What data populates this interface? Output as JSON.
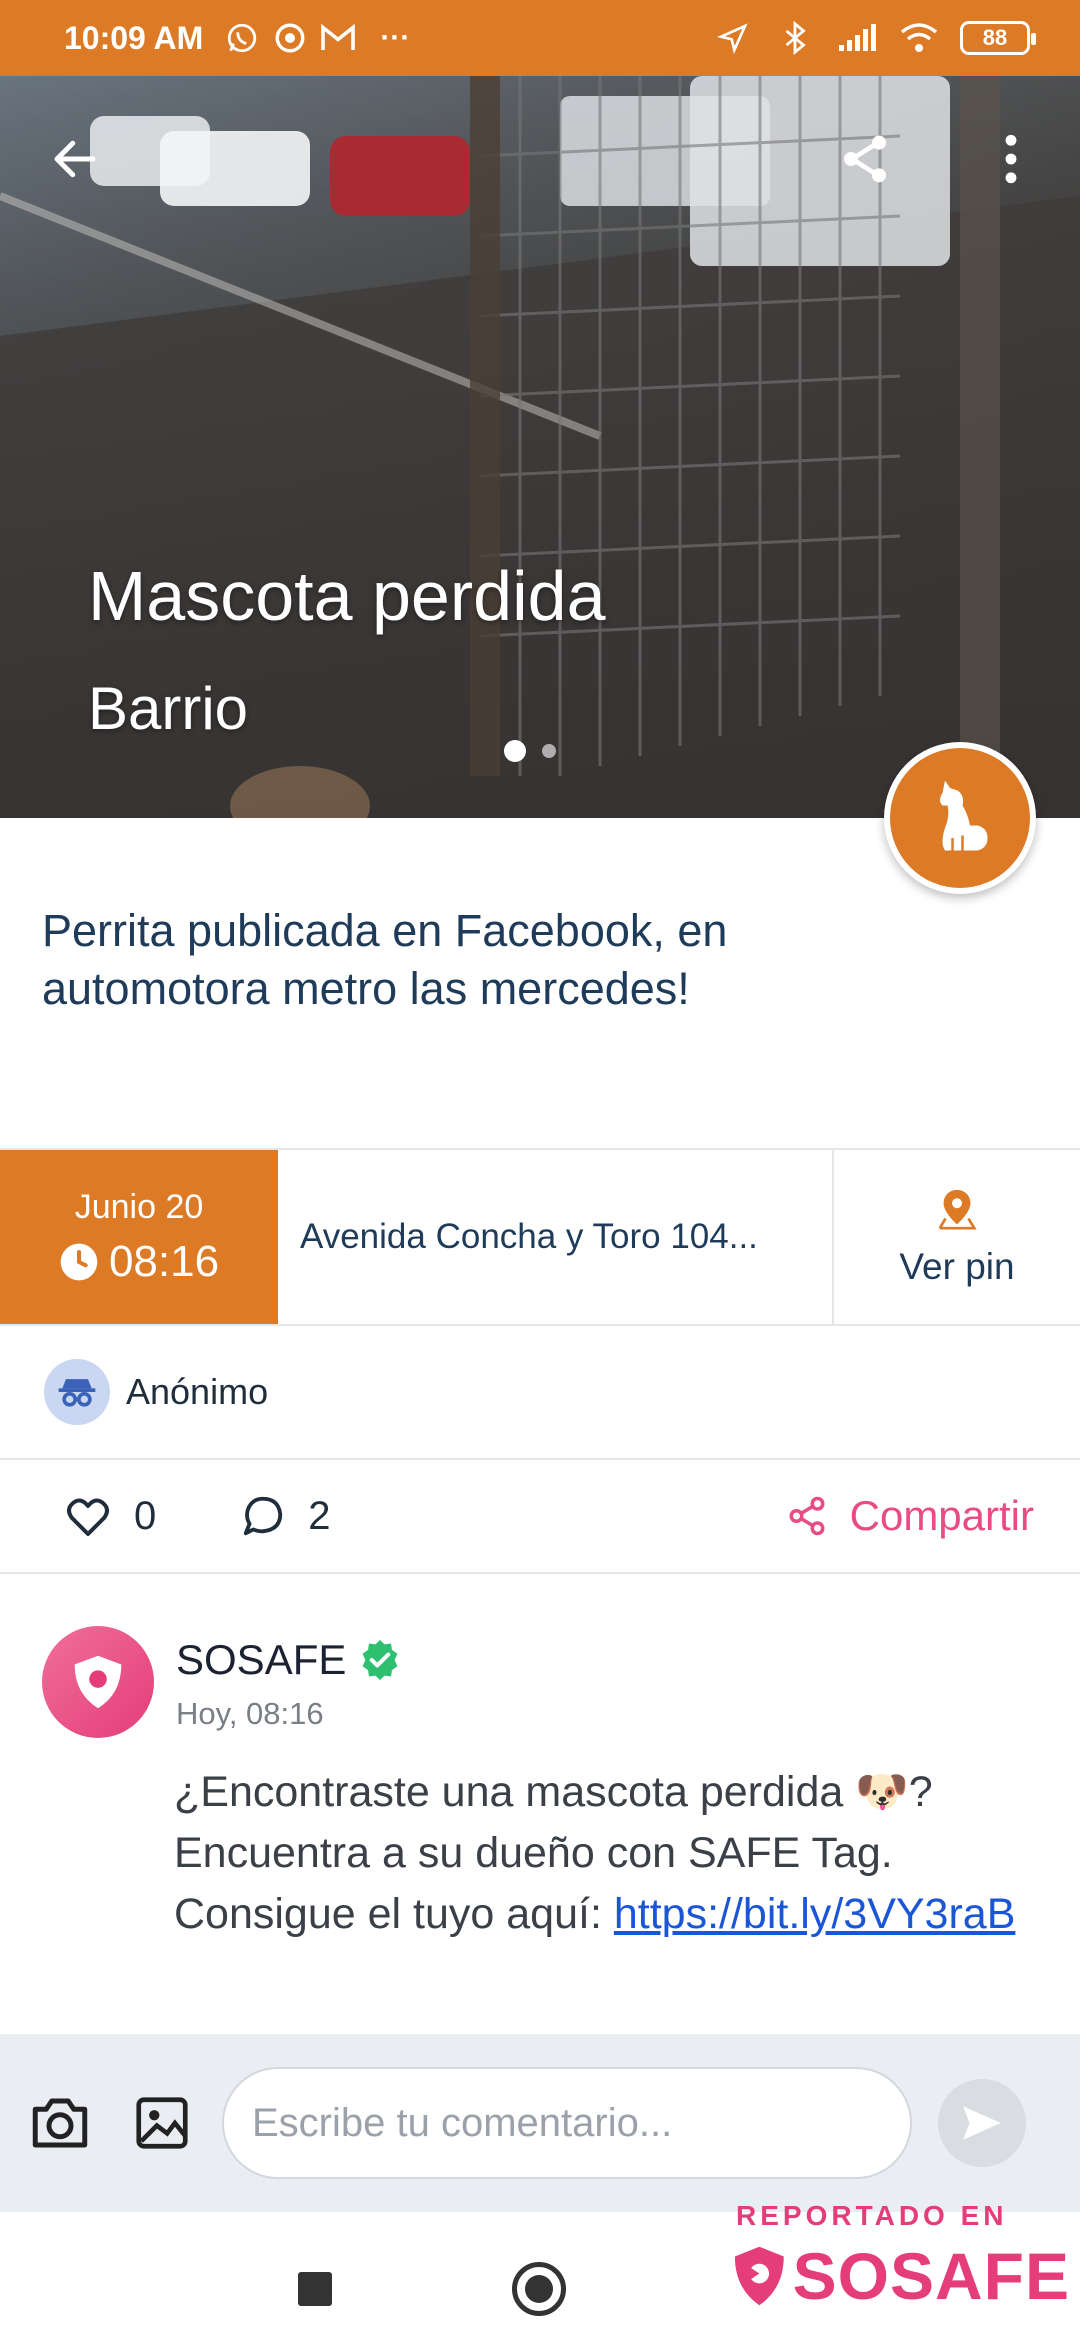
{
  "status_bar": {
    "time": "10:09 AM",
    "more": "···",
    "battery": "88"
  },
  "hero": {
    "title": "Mascota perdida",
    "subtitle": "Barrio",
    "slide_count": 2,
    "active_slide": 1,
    "category_icon": "dog-icon"
  },
  "post": {
    "description": "Perrita publicada en Facebook, en automotora metro las mercedes!",
    "date": "Junio 20",
    "time": "08:16",
    "address": "Avenida Concha y Toro  104...",
    "pin_label": "Ver pin",
    "author": "Anónimo"
  },
  "actions": {
    "likes": "0",
    "comments": "2",
    "share_label": "Compartir"
  },
  "comment": {
    "author": "SOSAFE",
    "time": "Hoy, 08:16",
    "text": "¿Encontraste una mascota perdida 🐶? Encuentra a su dueño con SAFE Tag. Consigue el tuyo aquí: ",
    "link": "https://bit.ly/3VY3raB"
  },
  "input": {
    "placeholder": "Escribe tu comentario..."
  },
  "watermark": {
    "top": "REPORTADO EN",
    "brand": "SOSAFE"
  },
  "colors": {
    "accent_orange": "#dd7a26",
    "brand_pink": "#e43d79",
    "verified_green": "#2fbf71",
    "text_navy": "#1f3b5a"
  }
}
